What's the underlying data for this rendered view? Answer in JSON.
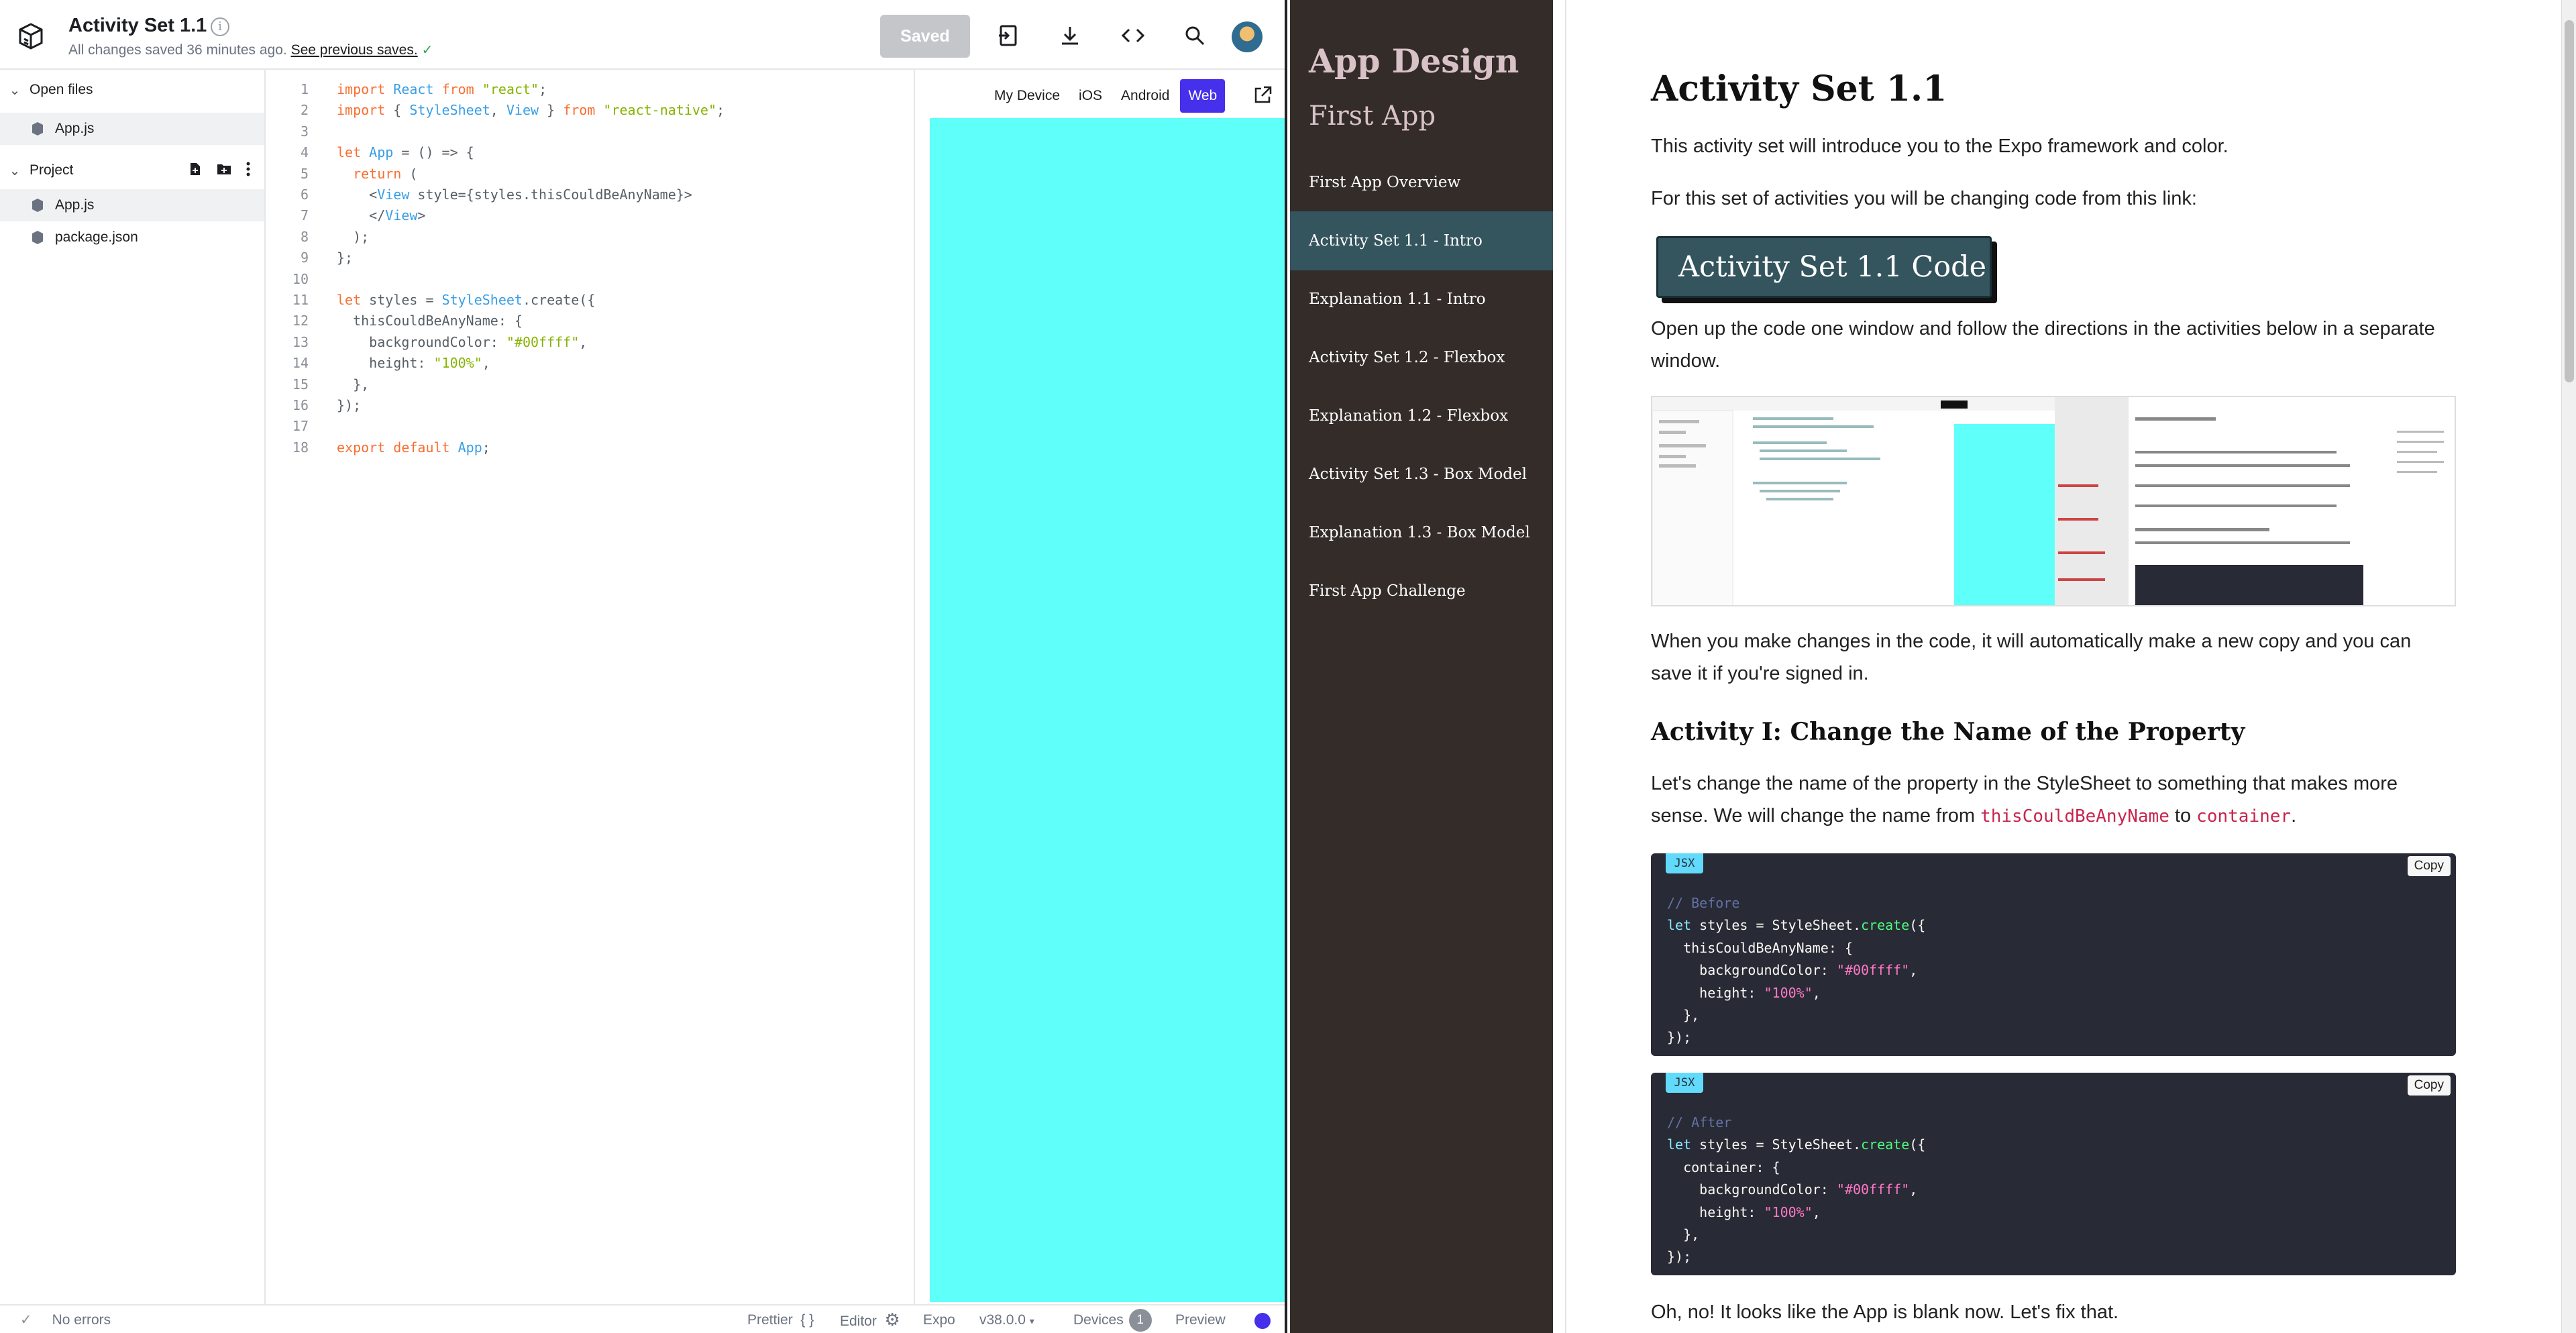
{
  "snack": {
    "title": "Activity Set 1.1",
    "save_status": "All changes saved 36 minutes ago.",
    "see_previous": "See previous saves.",
    "saved_button": "Saved",
    "sidebar": {
      "open_files_label": "Open files",
      "open_files": [
        "App.js"
      ],
      "project_label": "Project",
      "project_files": [
        "App.js",
        "package.json"
      ]
    },
    "editor": {
      "lines": [
        {
          "n": "1",
          "code": "import React from \"react\";"
        },
        {
          "n": "2",
          "code": "import { StyleSheet, View } from \"react-native\";"
        },
        {
          "n": "3",
          "code": ""
        },
        {
          "n": "4",
          "code": "let App = () => {"
        },
        {
          "n": "5",
          "code": "  return ("
        },
        {
          "n": "6",
          "code": "    <View style={styles.thisCouldBeAnyName}>"
        },
        {
          "n": "7",
          "code": "    </View>"
        },
        {
          "n": "8",
          "code": "  );"
        },
        {
          "n": "9",
          "code": "};"
        },
        {
          "n": "10",
          "code": ""
        },
        {
          "n": "11",
          "code": "let styles = StyleSheet.create({"
        },
        {
          "n": "12",
          "code": "  thisCouldBeAnyName: {"
        },
        {
          "n": "13",
          "code": "    backgroundColor: \"#00ffff\","
        },
        {
          "n": "14",
          "code": "    height: \"100%\","
        },
        {
          "n": "15",
          "code": "  },"
        },
        {
          "n": "16",
          "code": "});"
        },
        {
          "n": "17",
          "code": ""
        },
        {
          "n": "18",
          "code": "export default App;"
        }
      ]
    },
    "preview": {
      "tabs": [
        "My Device",
        "iOS",
        "Android",
        "Web"
      ],
      "active_tab": "Web",
      "screen_color": "#5ffffa"
    },
    "statusbar": {
      "errors": "No errors",
      "prettier": "Prettier",
      "prettier_braces": "{ }",
      "editor": "Editor",
      "expo": "Expo",
      "version": "v38.0.0",
      "devices": "Devices",
      "devices_count": "1",
      "preview": "Preview"
    }
  },
  "course": {
    "nav": {
      "title": "App Design",
      "subtitle": "First App",
      "items": [
        "First App Overview",
        "Activity Set 1.1 - Intro",
        "Explanation 1.1 - Intro",
        "Activity Set 1.2 - Flexbox",
        "Explanation 1.2 - Flexbox",
        "Activity Set 1.3 - Box Model",
        "Explanation 1.3 - Box Model",
        "First App Challenge"
      ],
      "active_index": 1
    },
    "article": {
      "heading": "Activity Set 1.1",
      "intro": "This activity set will introduce you to the Expo framework and color.",
      "link_sentence": "For this set of activities you will be changing code from this link:",
      "code_button": "Activity Set 1.1 Code",
      "open_directions": "Open up the code one window and follow the directions in the activities below in a separate window.",
      "changes_note": "When you make changes in the code, it will automatically make a new copy and you can save it if you're signed in.",
      "activity1_heading": "Activity I: Change the Name of the Property",
      "activity1_text_a": "Let's change the name of the property in the StyleSheet to something that makes more sense. We will change the name from ",
      "activity1_code_a": "thisCouldBeAnyName",
      "activity1_text_b": " to ",
      "activity1_code_b": "container",
      "activity1_text_c": ".",
      "code_lang": "JSX",
      "copy_label": "Copy",
      "before_code": [
        "// Before",
        "let styles = StyleSheet.create({",
        "  thisCouldBeAnyName: {",
        "    backgroundColor: \"#00ffff\",",
        "    height: \"100%\",",
        "  },",
        "});"
      ],
      "after_code": [
        "// After",
        "let styles = StyleSheet.create({",
        "  container: {",
        "    backgroundColor: \"#00ffff\",",
        "    height: \"100%\",",
        "  },",
        "});"
      ],
      "blank_note": "Oh, no! It looks like the App is blank now. Let's fix that."
    }
  }
}
